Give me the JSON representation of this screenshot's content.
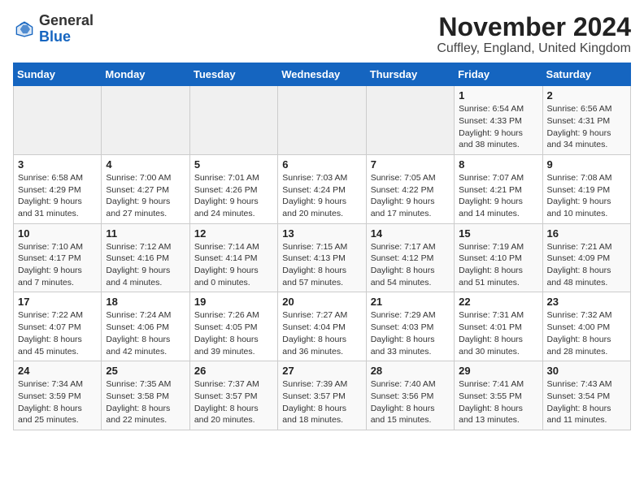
{
  "header": {
    "logo_line1": "General",
    "logo_line2": "Blue",
    "title": "November 2024",
    "subtitle": "Cuffley, England, United Kingdom"
  },
  "days_of_week": [
    "Sunday",
    "Monday",
    "Tuesday",
    "Wednesday",
    "Thursday",
    "Friday",
    "Saturday"
  ],
  "weeks": [
    [
      {
        "day": "",
        "info": ""
      },
      {
        "day": "",
        "info": ""
      },
      {
        "day": "",
        "info": ""
      },
      {
        "day": "",
        "info": ""
      },
      {
        "day": "",
        "info": ""
      },
      {
        "day": "1",
        "info": "Sunrise: 6:54 AM\nSunset: 4:33 PM\nDaylight: 9 hours and 38 minutes."
      },
      {
        "day": "2",
        "info": "Sunrise: 6:56 AM\nSunset: 4:31 PM\nDaylight: 9 hours and 34 minutes."
      }
    ],
    [
      {
        "day": "3",
        "info": "Sunrise: 6:58 AM\nSunset: 4:29 PM\nDaylight: 9 hours and 31 minutes."
      },
      {
        "day": "4",
        "info": "Sunrise: 7:00 AM\nSunset: 4:27 PM\nDaylight: 9 hours and 27 minutes."
      },
      {
        "day": "5",
        "info": "Sunrise: 7:01 AM\nSunset: 4:26 PM\nDaylight: 9 hours and 24 minutes."
      },
      {
        "day": "6",
        "info": "Sunrise: 7:03 AM\nSunset: 4:24 PM\nDaylight: 9 hours and 20 minutes."
      },
      {
        "day": "7",
        "info": "Sunrise: 7:05 AM\nSunset: 4:22 PM\nDaylight: 9 hours and 17 minutes."
      },
      {
        "day": "8",
        "info": "Sunrise: 7:07 AM\nSunset: 4:21 PM\nDaylight: 9 hours and 14 minutes."
      },
      {
        "day": "9",
        "info": "Sunrise: 7:08 AM\nSunset: 4:19 PM\nDaylight: 9 hours and 10 minutes."
      }
    ],
    [
      {
        "day": "10",
        "info": "Sunrise: 7:10 AM\nSunset: 4:17 PM\nDaylight: 9 hours and 7 minutes."
      },
      {
        "day": "11",
        "info": "Sunrise: 7:12 AM\nSunset: 4:16 PM\nDaylight: 9 hours and 4 minutes."
      },
      {
        "day": "12",
        "info": "Sunrise: 7:14 AM\nSunset: 4:14 PM\nDaylight: 9 hours and 0 minutes."
      },
      {
        "day": "13",
        "info": "Sunrise: 7:15 AM\nSunset: 4:13 PM\nDaylight: 8 hours and 57 minutes."
      },
      {
        "day": "14",
        "info": "Sunrise: 7:17 AM\nSunset: 4:12 PM\nDaylight: 8 hours and 54 minutes."
      },
      {
        "day": "15",
        "info": "Sunrise: 7:19 AM\nSunset: 4:10 PM\nDaylight: 8 hours and 51 minutes."
      },
      {
        "day": "16",
        "info": "Sunrise: 7:21 AM\nSunset: 4:09 PM\nDaylight: 8 hours and 48 minutes."
      }
    ],
    [
      {
        "day": "17",
        "info": "Sunrise: 7:22 AM\nSunset: 4:07 PM\nDaylight: 8 hours and 45 minutes."
      },
      {
        "day": "18",
        "info": "Sunrise: 7:24 AM\nSunset: 4:06 PM\nDaylight: 8 hours and 42 minutes."
      },
      {
        "day": "19",
        "info": "Sunrise: 7:26 AM\nSunset: 4:05 PM\nDaylight: 8 hours and 39 minutes."
      },
      {
        "day": "20",
        "info": "Sunrise: 7:27 AM\nSunset: 4:04 PM\nDaylight: 8 hours and 36 minutes."
      },
      {
        "day": "21",
        "info": "Sunrise: 7:29 AM\nSunset: 4:03 PM\nDaylight: 8 hours and 33 minutes."
      },
      {
        "day": "22",
        "info": "Sunrise: 7:31 AM\nSunset: 4:01 PM\nDaylight: 8 hours and 30 minutes."
      },
      {
        "day": "23",
        "info": "Sunrise: 7:32 AM\nSunset: 4:00 PM\nDaylight: 8 hours and 28 minutes."
      }
    ],
    [
      {
        "day": "24",
        "info": "Sunrise: 7:34 AM\nSunset: 3:59 PM\nDaylight: 8 hours and 25 minutes."
      },
      {
        "day": "25",
        "info": "Sunrise: 7:35 AM\nSunset: 3:58 PM\nDaylight: 8 hours and 22 minutes."
      },
      {
        "day": "26",
        "info": "Sunrise: 7:37 AM\nSunset: 3:57 PM\nDaylight: 8 hours and 20 minutes."
      },
      {
        "day": "27",
        "info": "Sunrise: 7:39 AM\nSunset: 3:57 PM\nDaylight: 8 hours and 18 minutes."
      },
      {
        "day": "28",
        "info": "Sunrise: 7:40 AM\nSunset: 3:56 PM\nDaylight: 8 hours and 15 minutes."
      },
      {
        "day": "29",
        "info": "Sunrise: 7:41 AM\nSunset: 3:55 PM\nDaylight: 8 hours and 13 minutes."
      },
      {
        "day": "30",
        "info": "Sunrise: 7:43 AM\nSunset: 3:54 PM\nDaylight: 8 hours and 11 minutes."
      }
    ]
  ]
}
